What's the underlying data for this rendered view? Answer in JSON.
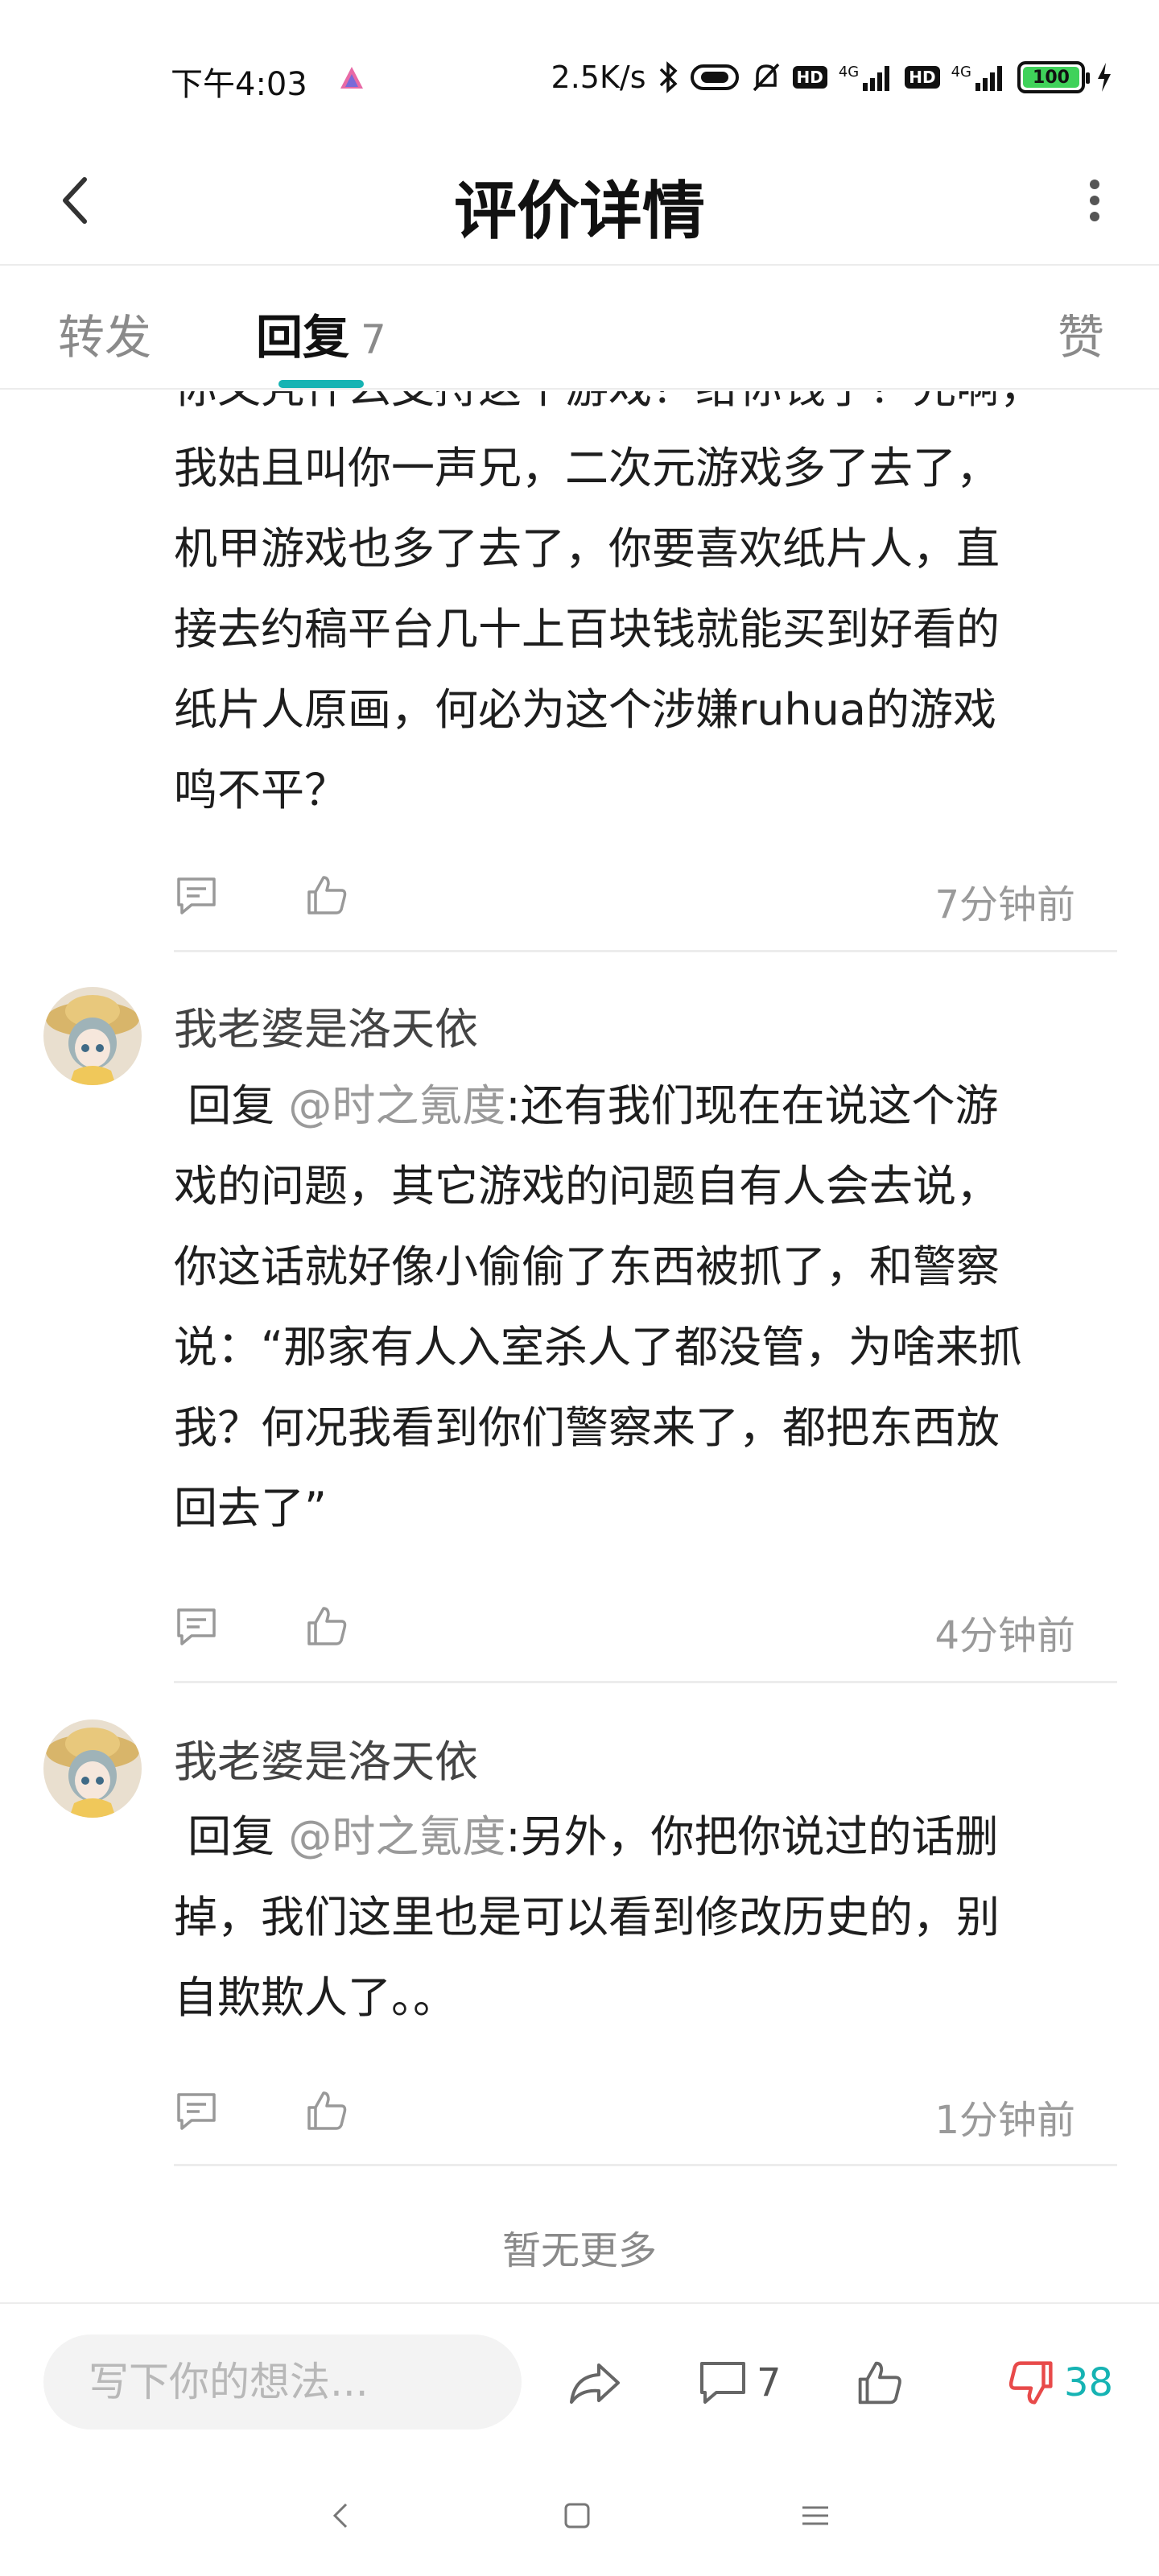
{
  "status_bar": {
    "time": "下午4:03",
    "net_speed": "2.5K/s",
    "hd1": "HD",
    "hd2": "HD",
    "sig1": "4G",
    "sig2": "4G",
    "battery": "100"
  },
  "header": {
    "title": "评价详情"
  },
  "tabs": {
    "forward": "转发",
    "reply": "回复",
    "reply_count": "7",
    "likes": "赞"
  },
  "comments": [
    {
      "body_lines": [
        "你又凭什么支持这个游戏？给你钱了？兄啊，",
        "我姑且叫你一声兄，二次元游戏多了去了，",
        "机甲游戏也多了去了，你要喜欢纸片人，直",
        "接去约稿平台几十上百块钱就能买到好看的",
        "纸片人原画，何必为这个涉嫌ruhua的游戏",
        "鸣不平？"
      ],
      "time": "7分钟前"
    },
    {
      "author": "我老婆是洛天依",
      "reply_prefix": "回复",
      "mention": "@时之氪度",
      "first_line_rest": ":还有我们现在在说这个游",
      "body_lines": [
        "戏的问题，其它游戏的问题自有人会去说，",
        "你这话就好像小偷偷了东西被抓了，和警察",
        "说：“那家有人入室杀人了都没管，为啥来抓",
        "我？何况我看到你们警察来了，都把东西放",
        "回去了”"
      ],
      "time": "4分钟前"
    },
    {
      "author": "我老婆是洛天依",
      "reply_prefix": "回复",
      "mention": "@时之氪度",
      "first_line_rest": ":另外，你把你说过的话删",
      "body_lines": [
        "掉，我们这里也是可以看到修改历史的，别",
        "自欺欺人了。。"
      ],
      "time": "1分钟前"
    }
  ],
  "no_more": "暂无更多",
  "bottom_bar": {
    "input_placeholder": "写下你的想法...",
    "comment_count": "7",
    "dislike_count": "38"
  },
  "colors": {
    "accent": "#16b3b3",
    "dislike": "#e84a4a",
    "muted": "#9a9a9a"
  },
  "icons": [
    "back-icon",
    "more-icon",
    "comment-icon",
    "like-icon",
    "share-icon",
    "dislike-icon"
  ]
}
